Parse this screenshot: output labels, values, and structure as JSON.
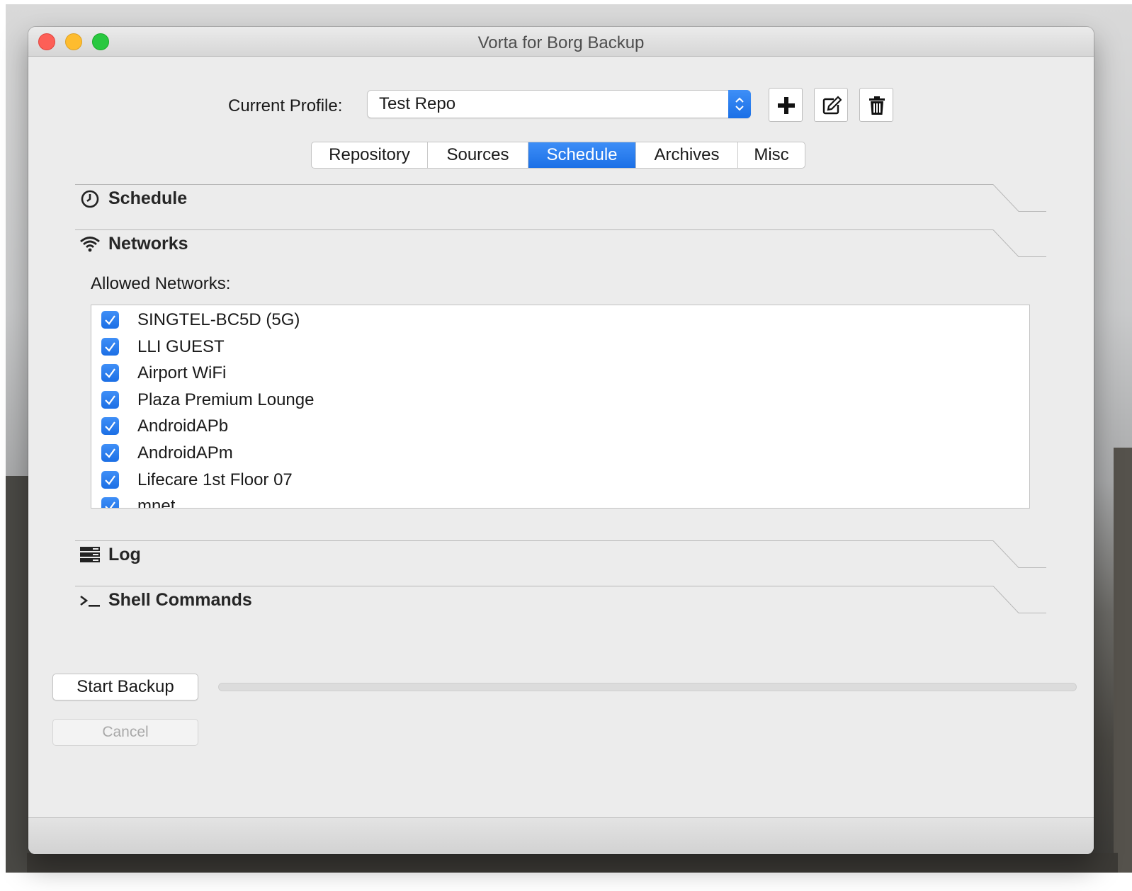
{
  "window": {
    "title": "Vorta for Borg Backup"
  },
  "profile": {
    "label": "Current Profile:",
    "selected": "Test Repo"
  },
  "toolbar": {
    "add_icon": "plus-icon",
    "edit_icon": "edit-icon",
    "delete_icon": "trash-icon"
  },
  "tabs": [
    {
      "label": "Repository",
      "active": false
    },
    {
      "label": "Sources",
      "active": false
    },
    {
      "label": "Schedule",
      "active": true
    },
    {
      "label": "Archives",
      "active": false
    },
    {
      "label": "Misc",
      "active": false
    }
  ],
  "sections": {
    "schedule": {
      "label": "Schedule",
      "icon": "clock-icon",
      "expanded": false
    },
    "networks": {
      "label": "Networks",
      "icon": "wifi-icon",
      "expanded": true
    },
    "log": {
      "label": "Log",
      "icon": "log-icon",
      "expanded": false
    },
    "shell": {
      "label": "Shell Commands",
      "icon": "terminal-icon",
      "expanded": false
    }
  },
  "networks": {
    "allowed_label": "Allowed Networks:",
    "items": [
      {
        "name": "SINGTEL-BC5D (5G)",
        "checked": true
      },
      {
        "name": "LLI GUEST",
        "checked": true
      },
      {
        "name": "Airport WiFi",
        "checked": true
      },
      {
        "name": "Plaza Premium Lounge",
        "checked": true
      },
      {
        "name": "AndroidAPb",
        "checked": true
      },
      {
        "name": "AndroidAPm",
        "checked": true
      },
      {
        "name": "Lifecare 1st Floor 07",
        "checked": true
      },
      {
        "name": "mnet",
        "checked": true
      }
    ]
  },
  "actions": {
    "start_label": "Start Backup",
    "cancel_label": "Cancel",
    "progress_percent": 0
  },
  "colors": {
    "accent": "#1c70e6",
    "window_bg": "#ececec"
  }
}
